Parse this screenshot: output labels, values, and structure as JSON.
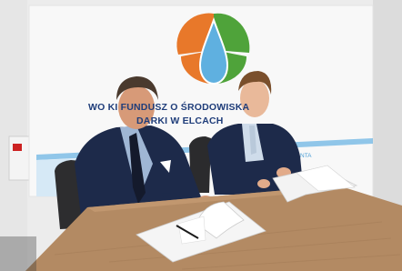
{
  "photo": {
    "banner": {
      "line1": "WO        KI FUNDUSZ O           ŚRODOWISKA",
      "line2": "DARKI W         ELCACH",
      "sub": "NTA"
    },
    "colors": {
      "banner_text": "#1f3d7a",
      "logo_orange": "#e8782a",
      "logo_green": "#4fa33a",
      "logo_drop": "#5fb0e0",
      "table": "#b38a63",
      "suit": "#1d2a4a"
    }
  }
}
